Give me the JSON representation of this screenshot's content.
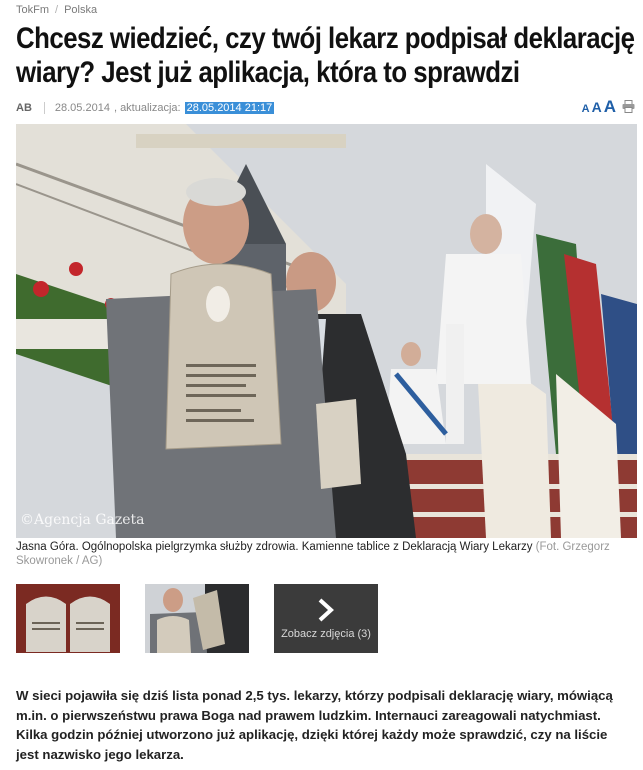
{
  "breadcrumb": {
    "items": [
      "TokFm",
      "Polska"
    ]
  },
  "article": {
    "title": "Chcesz wiedzieć, czy twój lekarz podpisał deklarację wiary? Jest już aplikacja, która to sprawdzi",
    "author": "AB",
    "date": "28.05.2014",
    "updated_label": ", aktualizacja:",
    "updated_value": "28.05.2014 21:17",
    "lead": "W sieci pojawiła się dziś lista ponad 2,5 tys. lekarzy, którzy podpisali deklarację wiary, mówiącą m.in. o pierwszeństwu prawa Boga nad prawem ludzkim. Internauci zareagowali natychmiast. Kilka godzin później utworzono już aplikację, dzięki której każdy może sprawdzić, czy na liście jest nazwisko jego lekarza."
  },
  "tools": {
    "font_small": "A",
    "font_medium": "A",
    "font_large": "A",
    "print_icon": "printer-icon"
  },
  "photo": {
    "watermark": "©Agencja Gazeta",
    "caption": "Jasna Góra. Ogólnopolska pielgrzymka służby zdrowia. Kamienne tablice z Deklaracją Wiary Lekarzy",
    "credit": "(Fot. Grzegorz Skowronek / AG)"
  },
  "gallery": {
    "more_label": "Zobacz zdjęcia (3)",
    "more_icon": "chevron-right-icon"
  },
  "colors": {
    "highlight": "#3a8fd8",
    "link": "#1f5fa8",
    "gallery_bg": "#3b3b3b"
  }
}
